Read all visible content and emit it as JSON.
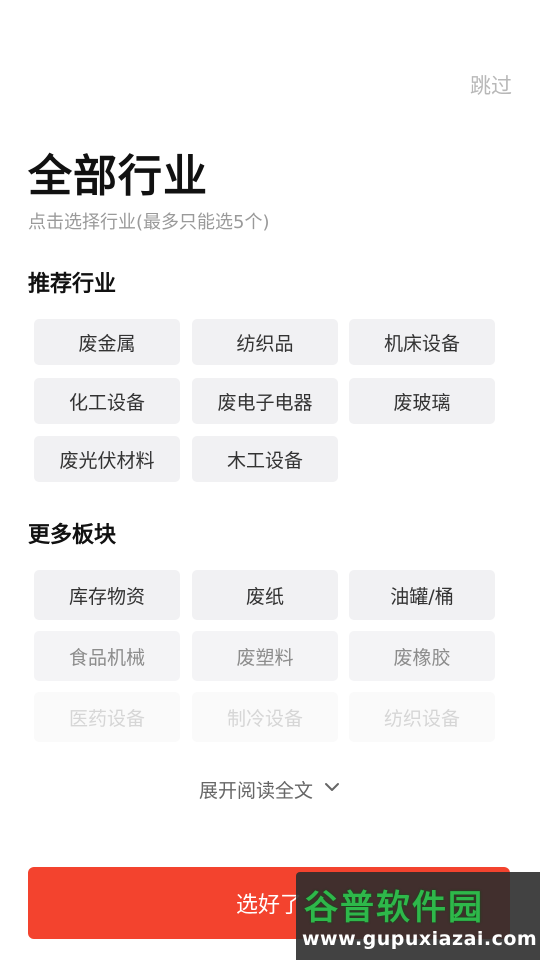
{
  "header": {
    "skip_label": "跳过",
    "title": "全部行业",
    "subtitle": "点击选择行业(最多只能选5个)"
  },
  "recommended": {
    "title": "推荐行业",
    "items": [
      "废金属",
      "纺织品",
      "机床设备",
      "化工设备",
      "废电子电器",
      "废玻璃",
      "废光伏材料",
      "木工设备"
    ]
  },
  "more": {
    "title": "更多板块",
    "items": [
      "库存物资",
      "废纸",
      "油罐/桶",
      "食品机械",
      "废塑料",
      "废橡胶",
      "医药设备",
      "制冷设备",
      "纺织设备"
    ]
  },
  "expand_label": "展开阅读全文",
  "confirm_label": "选好了",
  "watermark": {
    "brand": "谷普软件园",
    "url": "www.gupuxiazai.com"
  },
  "colors": {
    "accent": "#f3432e",
    "chip_bg": "#f1f1f3"
  }
}
